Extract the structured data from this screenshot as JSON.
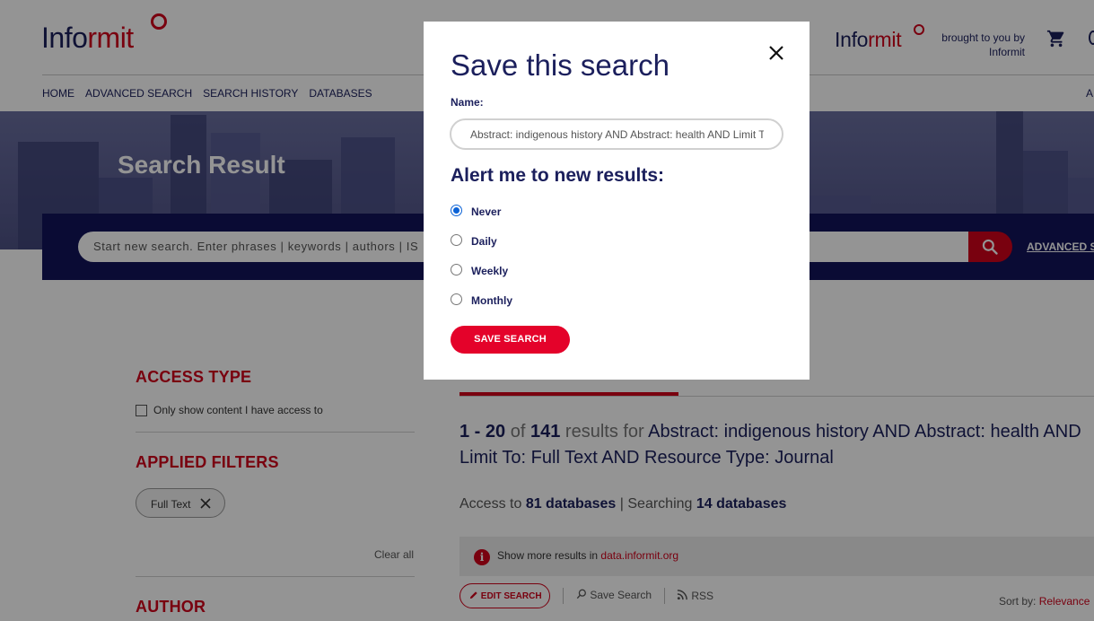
{
  "header": {
    "logo_info": "Info",
    "logo_rmit": "rmit",
    "brought_by": "brought to you by Informit",
    "nav": [
      "HOME",
      "ADVANCED SEARCH",
      "SEARCH HISTORY",
      "DATABASES"
    ],
    "nav_cut": "A"
  },
  "hero": {
    "title": "Search Result",
    "search_placeholder": "Start new search. Enter phrases | keywords | authors | IS",
    "advanced_link": "ADVANCED S"
  },
  "sidebar": {
    "access_type_title": "ACCESS TYPE",
    "access_checkbox_label": "Only show content I have access to",
    "applied_filters_title": "APPLIED FILTERS",
    "filter_chip": "Full Text",
    "clear_all": "Clear all",
    "author_title": "AUTHOR"
  },
  "results": {
    "range": "1 - 20",
    "of": "of",
    "total": "141",
    "results_for": "results for",
    "query": "Abstract: indigenous history AND Abstract: health AND Limit To: Full Text AND Resource Type: Journal",
    "access_to": "Access to",
    "access_dbs": "81 databases",
    "searching": "| Searching",
    "searching_dbs": "14 databases",
    "info_text": "Show more results in",
    "info_link": "data.informit.org",
    "edit_search": "EDIT SEARCH",
    "save_search": "Save Search",
    "rss": "RSS",
    "sort_by": "Sort by:",
    "sort_value": "Relevance"
  },
  "modal": {
    "title": "Save this search",
    "name_label": "Name:",
    "name_value": "Abstract: indigenous history AND Abstract: health AND Limit To: Full Text AND Resource Type: Journal",
    "alert_title": "Alert me to new results:",
    "options": [
      {
        "label": "Never",
        "selected": true
      },
      {
        "label": "Daily",
        "selected": false
      },
      {
        "label": "Weekly",
        "selected": false
      },
      {
        "label": "Monthly",
        "selected": false
      }
    ],
    "save_button": "SAVE SEARCH"
  },
  "colors": {
    "brand_red": "#d0021b",
    "navy": "#1b1f5c",
    "search_band": "#12145a",
    "radio_selected": "#0b62d6"
  },
  "icons": [
    "close-icon",
    "search-icon",
    "cart-icon",
    "info-icon",
    "pencil-icon",
    "magnifier-icon",
    "rss-icon",
    "chip-close-icon"
  ]
}
